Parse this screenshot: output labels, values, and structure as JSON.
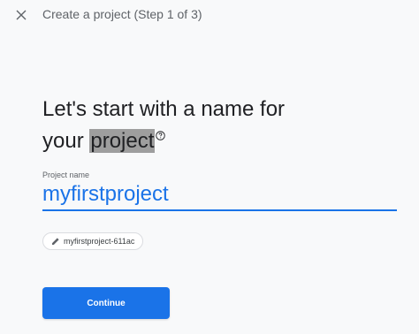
{
  "header": {
    "title": "Create a project (Step 1 of 3)",
    "close_icon": "close-icon"
  },
  "main": {
    "headline_part1": "Let's start with a name for",
    "headline_part2": "your ",
    "headline_highlight": "project",
    "help_icon": "help-icon",
    "field_label": "Project name",
    "project_name_value": "myfirstproject",
    "project_id_chip": "myfirstproject-611ac",
    "continue_label": "Continue"
  },
  "colors": {
    "accent": "#1a73e8",
    "highlight": "#9e9e9e",
    "text": "#202124",
    "secondary_text": "#5f6368"
  }
}
